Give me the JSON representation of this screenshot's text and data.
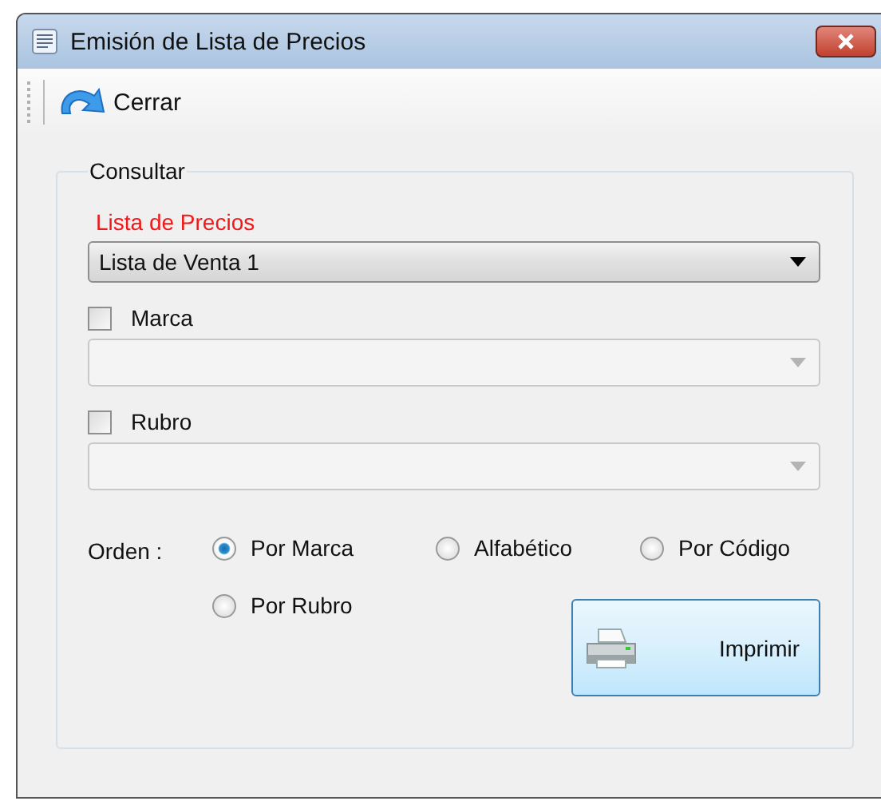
{
  "window": {
    "title": "Emisión de Lista de Precios"
  },
  "toolbar": {
    "buttons": [
      {
        "label": "Cerrar"
      }
    ]
  },
  "group": {
    "title": "Consultar",
    "price_list": {
      "label": "Lista de Precios",
      "value": "Lista de Venta 1",
      "disabled": false
    },
    "filters": [
      {
        "label": "Marca",
        "checked": false,
        "disabled": true
      },
      {
        "label": "Rubro",
        "checked": false,
        "disabled": true
      }
    ],
    "order": {
      "label": "Orden :",
      "options": [
        {
          "label": "Por Marca",
          "selected": true
        },
        {
          "label": "Alfabético",
          "selected": false
        },
        {
          "label": "Por Código",
          "selected": false
        },
        {
          "label": "Por Rubro",
          "selected": false
        }
      ]
    },
    "print_button": {
      "label": "Imprimir"
    }
  }
}
